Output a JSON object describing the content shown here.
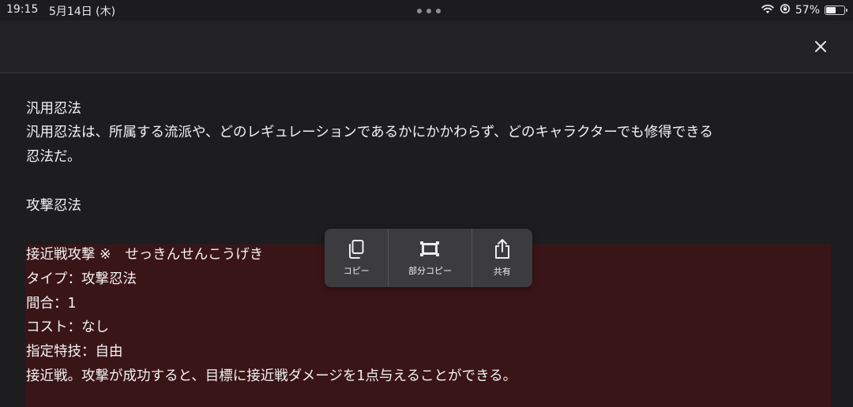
{
  "status_bar": {
    "time": "19:15",
    "date": "5月14日 (木)",
    "battery_text": "57%",
    "battery_level": 0.57,
    "icons": [
      "wifi-icon",
      "orientation-lock-icon",
      "battery-icon"
    ]
  },
  "header": {
    "close_icon": "close-icon"
  },
  "content": {
    "lines": [
      "汎用忍法",
      "汎用忍法は、所属する流派や、どのレギュレーションであるかにかかわらず、どのキャラクターでも修得できる",
      "忍法だ。",
      "攻撃忍法",
      "接近戦攻撃 ※　せっきんせんこうげき",
      "タイプ：攻撃忍法",
      "間合：1",
      "コスト：なし",
      "指定特技：自由",
      "接近戦。攻撃が成功すると、目標に接近戦ダメージを1点与えることができる。"
    ],
    "selection_color": "#3a1517"
  },
  "context_menu": {
    "copy_label": "コピー",
    "partial_copy_label": "部分コピー",
    "share_label": "共有",
    "icons": [
      "copy-icon",
      "crop-icon",
      "share-icon"
    ]
  }
}
